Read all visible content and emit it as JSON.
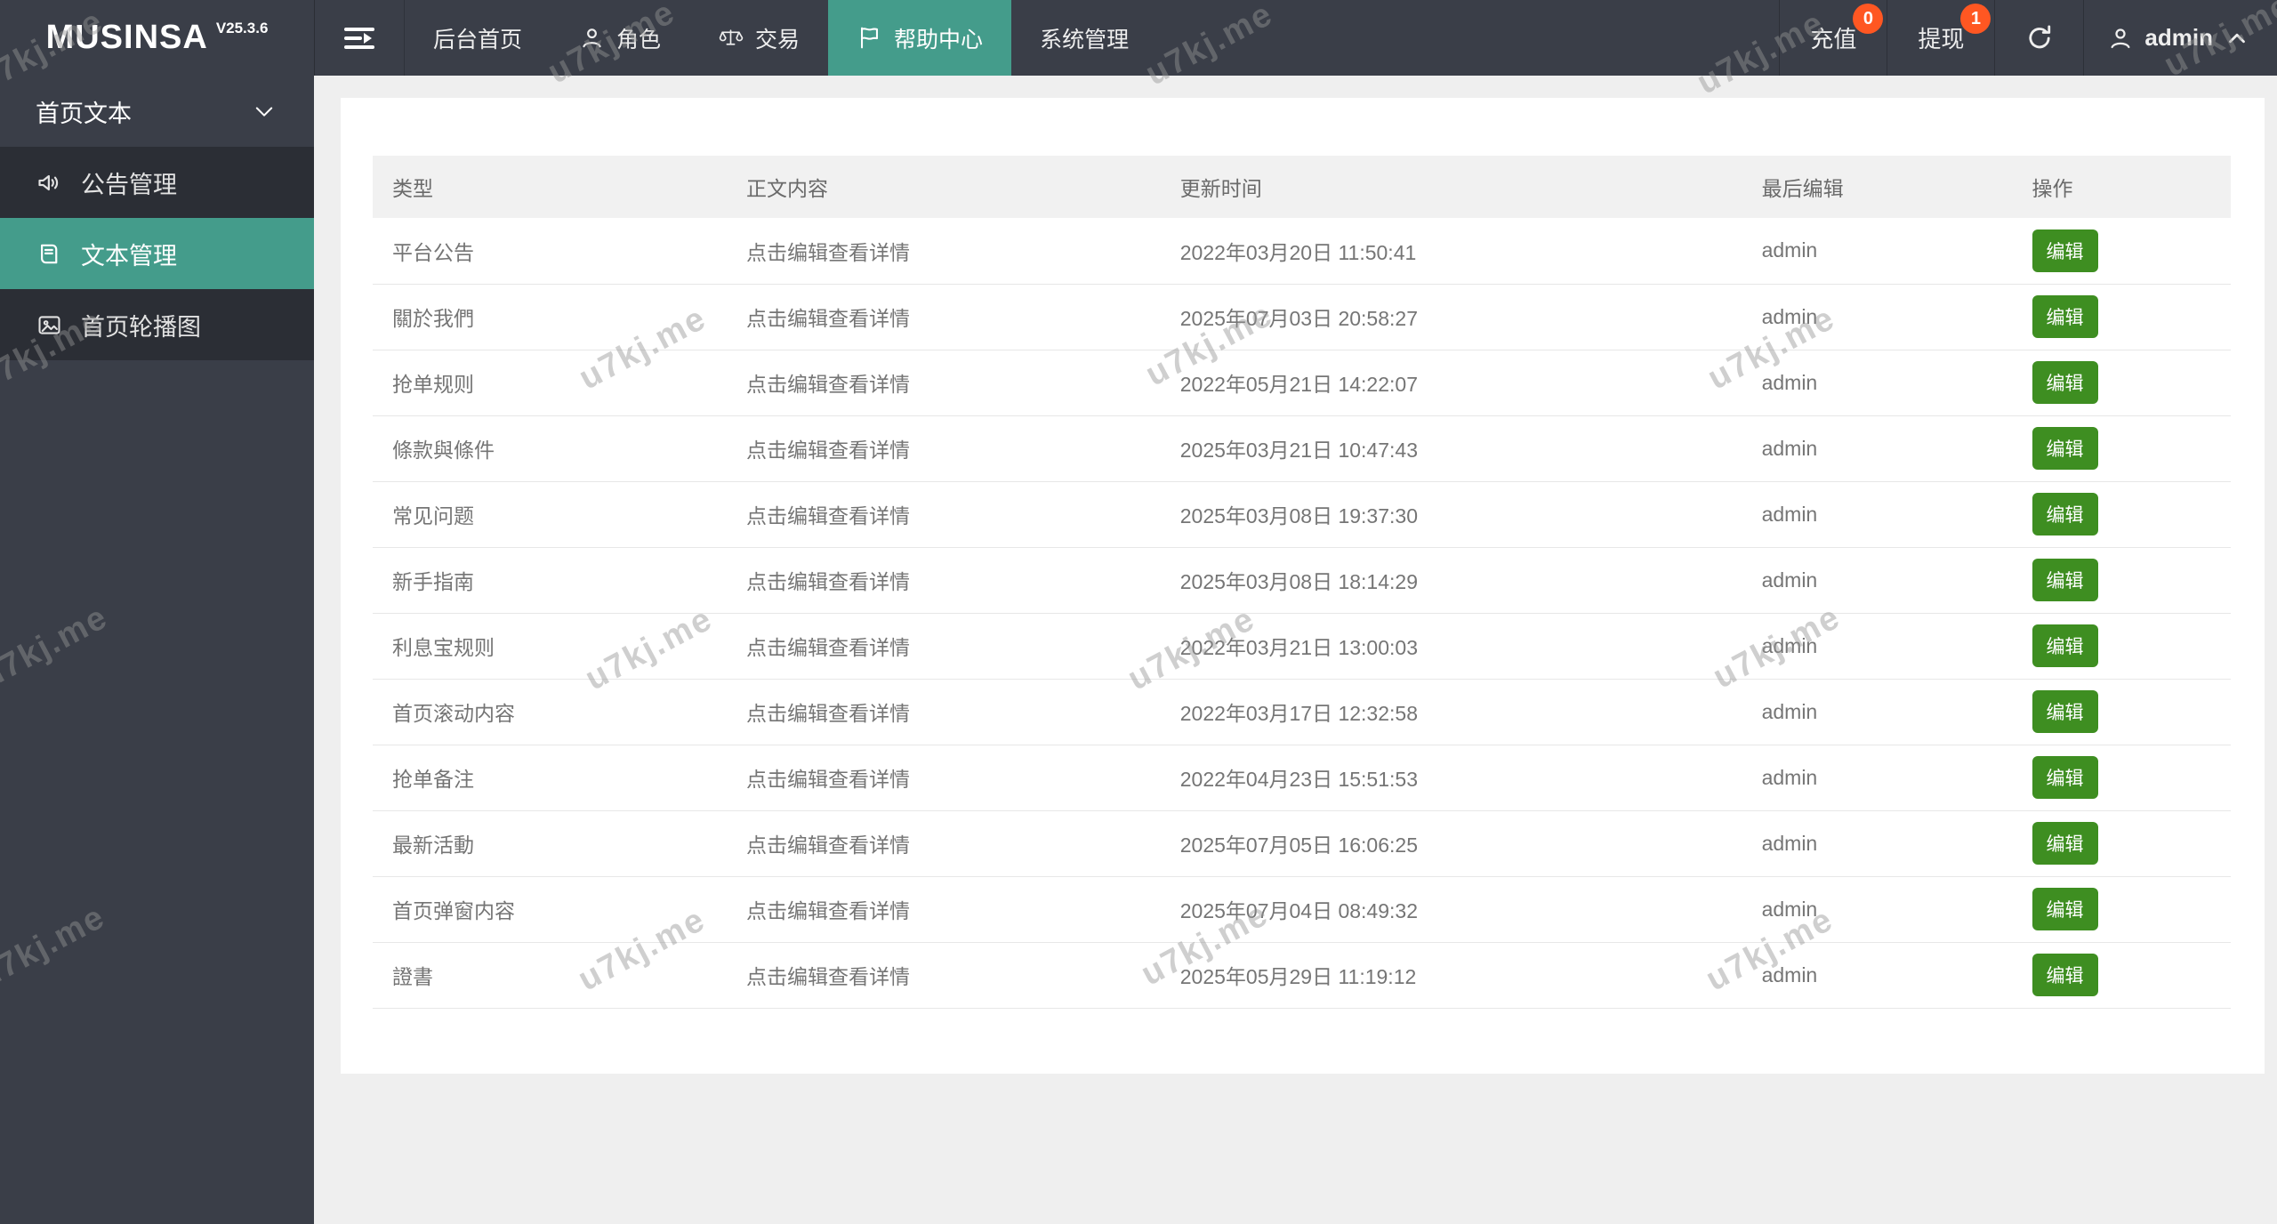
{
  "app": {
    "brand": "MUSINSA",
    "version": "V25.3.6"
  },
  "topnav": {
    "items": [
      {
        "name": "backend-home",
        "label": "后台首页",
        "icon": null,
        "active": false
      },
      {
        "name": "roles",
        "label": "角色",
        "icon": "person-icon",
        "active": false
      },
      {
        "name": "trade",
        "label": "交易",
        "icon": "scales-icon",
        "active": false
      },
      {
        "name": "help-center",
        "label": "帮助中心",
        "icon": "flag-icon",
        "active": true
      },
      {
        "name": "system-admin",
        "label": "系统管理",
        "icon": null,
        "active": false
      }
    ],
    "recharge": {
      "label": "充值",
      "badge": "0"
    },
    "withdraw": {
      "label": "提现",
      "badge": "1"
    },
    "user": {
      "name": "admin"
    }
  },
  "sidebar": {
    "group": {
      "label": "首页文本"
    },
    "items": [
      {
        "name": "announcement-management",
        "label": "公告管理",
        "icon": "speaker-icon",
        "active": false
      },
      {
        "name": "text-management",
        "label": "文本管理",
        "icon": "book-icon",
        "active": true
      },
      {
        "name": "homepage-carousel",
        "label": "首页轮播图",
        "icon": "image-icon",
        "active": false
      }
    ]
  },
  "table": {
    "columns": [
      "类型",
      "正文内容",
      "更新时间",
      "最后编辑",
      "操作"
    ],
    "edit_label": "编辑",
    "rows": [
      {
        "type": "平台公告",
        "content": "点击编辑查看详情",
        "updated": "2022年03月20日 11:50:41",
        "editor": "admin"
      },
      {
        "type": "關於我們",
        "content": "点击编辑查看详情",
        "updated": "2025年07月03日 20:58:27",
        "editor": "admin"
      },
      {
        "type": "抢单规则",
        "content": "点击编辑查看详情",
        "updated": "2022年05月21日 14:22:07",
        "editor": "admin"
      },
      {
        "type": "條款與條件",
        "content": "点击编辑查看详情",
        "updated": "2025年03月21日 10:47:43",
        "editor": "admin"
      },
      {
        "type": "常见问题",
        "content": "点击编辑查看详情",
        "updated": "2025年03月08日 19:37:30",
        "editor": "admin"
      },
      {
        "type": "新手指南",
        "content": "点击编辑查看详情",
        "updated": "2025年03月08日 18:14:29",
        "editor": "admin"
      },
      {
        "type": "利息宝规则",
        "content": "点击编辑查看详情",
        "updated": "2022年03月21日 13:00:03",
        "editor": "admin"
      },
      {
        "type": "首页滚动内容",
        "content": "点击编辑查看详情",
        "updated": "2022年03月17日 12:32:58",
        "editor": "admin"
      },
      {
        "type": "抢单备注",
        "content": "点击编辑查看详情",
        "updated": "2022年04月23日 15:51:53",
        "editor": "admin"
      },
      {
        "type": "最新活動",
        "content": "点击编辑查看详情",
        "updated": "2025年07月05日 16:06:25",
        "editor": "admin"
      },
      {
        "type": "首页弹窗内容",
        "content": "点击编辑查看详情",
        "updated": "2025年07月04日 08:49:32",
        "editor": "admin"
      },
      {
        "type": "證書",
        "content": "点击编辑查看详情",
        "updated": "2025年05月29日 11:19:12",
        "editor": "admin"
      }
    ]
  },
  "watermark": {
    "text": "u7kj.me"
  },
  "colors": {
    "topbar_bg": "#3a3e48",
    "submenu_bg": "#2b2e35",
    "accent_teal": "#449c8b",
    "button_green": "#3e8e21",
    "badge_orange": "#ff5722",
    "page_bg": "#efefef"
  }
}
